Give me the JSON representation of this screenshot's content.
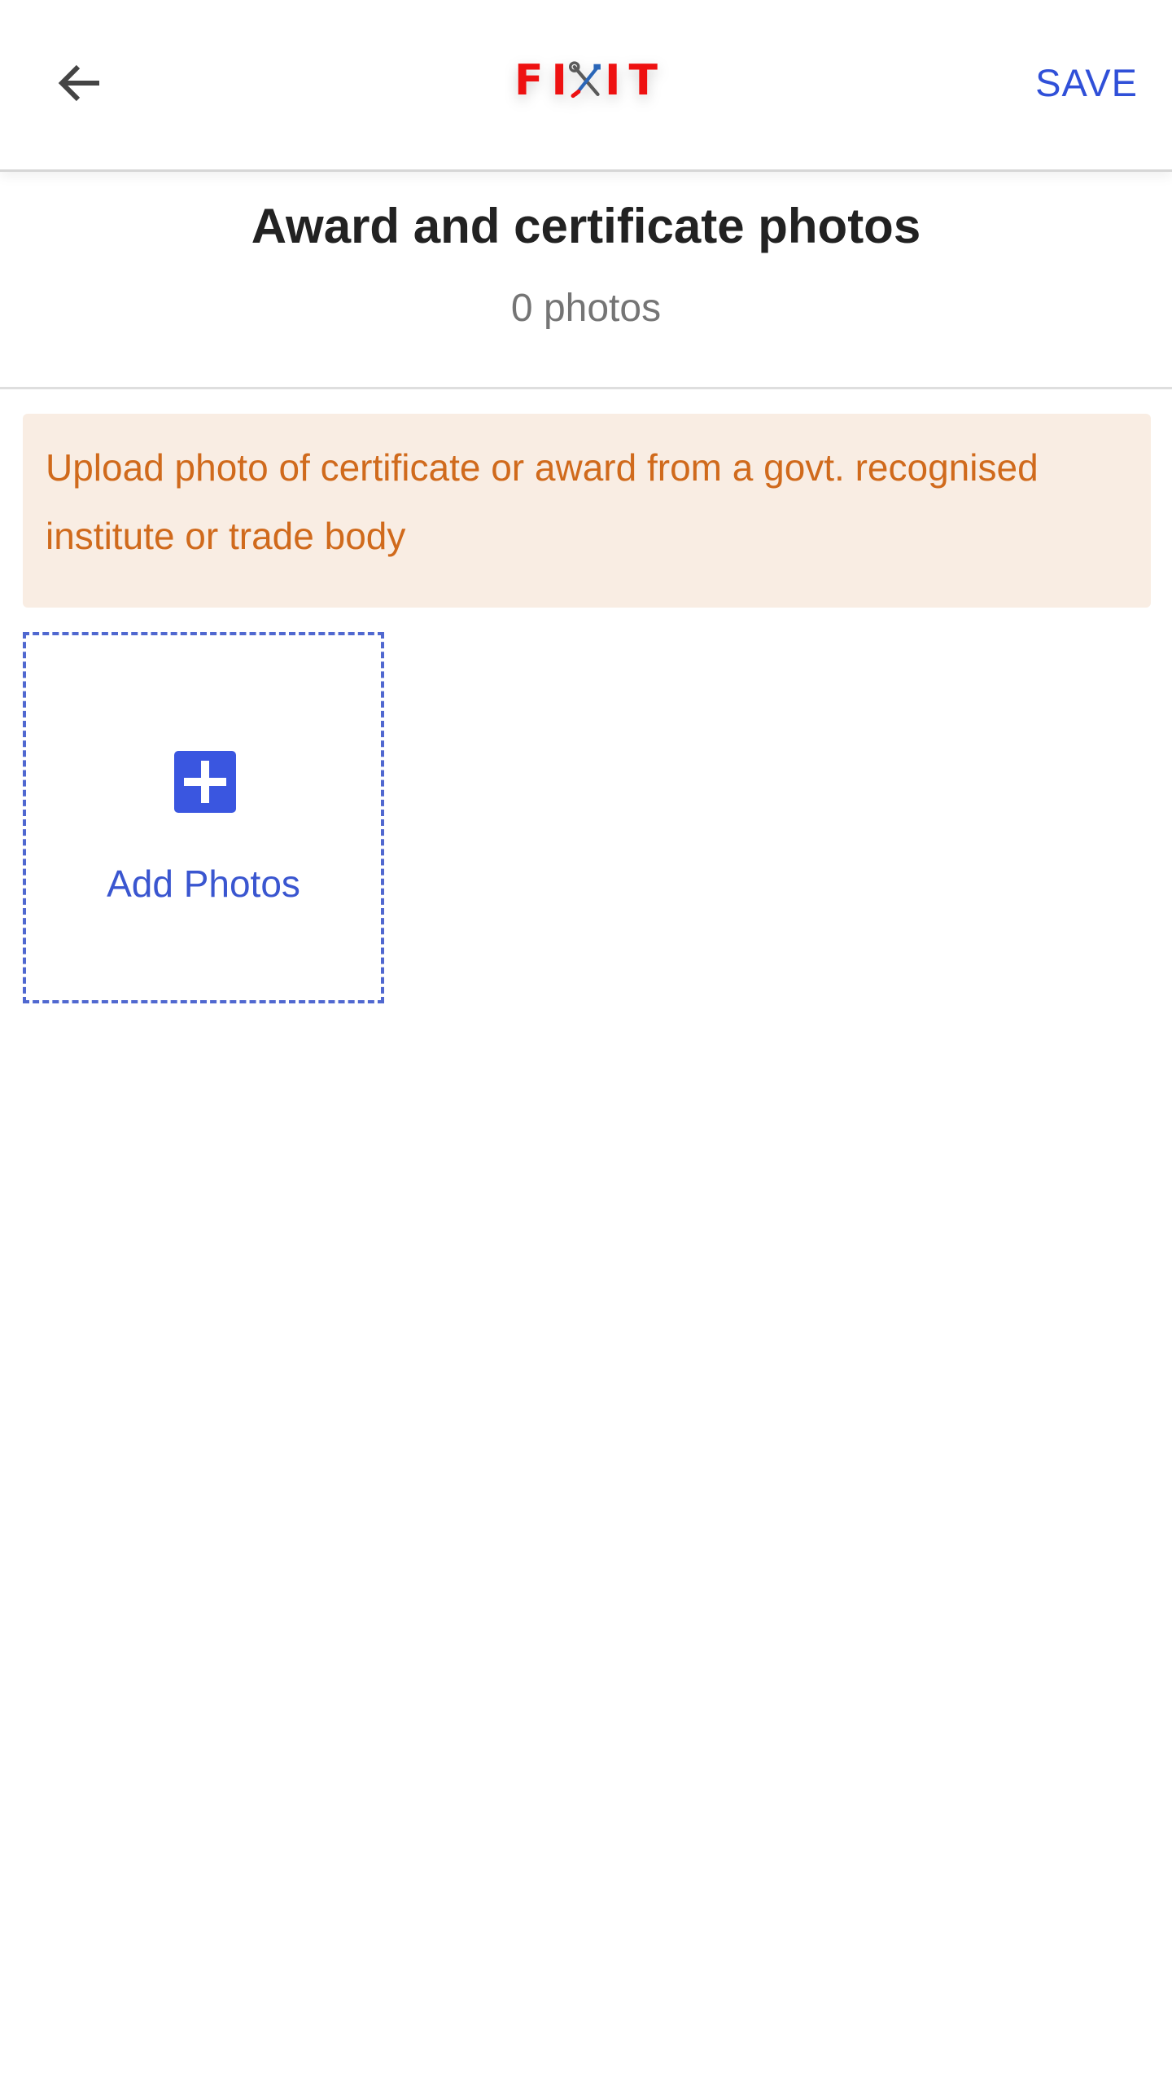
{
  "app_bar": {
    "logo": {
      "letters": [
        "F",
        "I",
        "I",
        "T"
      ],
      "text": "FIXIT",
      "tool_icon": "crossed-wrench-screwdriver-icon",
      "color": "#ee1111"
    },
    "back_icon": "arrow-left-icon",
    "save_label": "SAVE",
    "accent_color": "#3050d8"
  },
  "header": {
    "title": "Award and certificate photos",
    "photo_count": "0 photos"
  },
  "notice": {
    "text": "Upload photo of certificate or award from a govt. recognised institute or trade body",
    "background": "#f9ede3",
    "color": "#d06a1c"
  },
  "add_photos": {
    "icon": "plus-square-icon",
    "label": "Add Photos"
  }
}
